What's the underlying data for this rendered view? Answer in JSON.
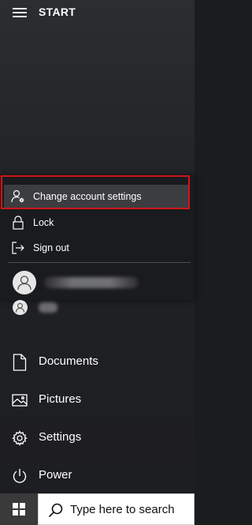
{
  "header": {
    "title": "START",
    "menu_icon": "hamburger-icon"
  },
  "account_flyout": {
    "highlight_color": "#d0141a",
    "items": [
      {
        "label": "Change account settings",
        "icon": "user-gear-icon"
      },
      {
        "label": "Lock",
        "icon": "lock-icon"
      },
      {
        "label": "Sign out",
        "icon": "sign-out-icon"
      }
    ]
  },
  "menu": {
    "items": [
      {
        "label": "Documents",
        "icon": "document-icon"
      },
      {
        "label": "Pictures",
        "icon": "picture-icon"
      },
      {
        "label": "Settings",
        "icon": "gear-icon"
      },
      {
        "label": "Power",
        "icon": "power-icon"
      }
    ]
  },
  "taskbar": {
    "start_icon": "windows-logo-icon",
    "search_placeholder": "Type here to search",
    "search_icon": "search-icon"
  }
}
